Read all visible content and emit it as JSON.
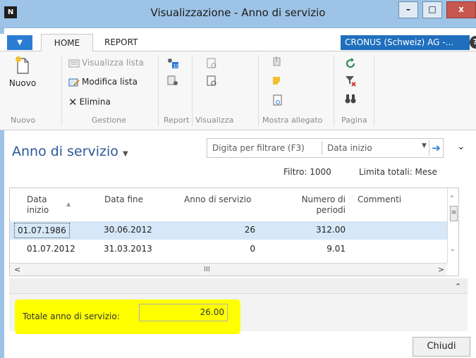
{
  "window": {
    "title": "Visualizzazione - Anno di servizio",
    "minimize": "–",
    "maximize": "□",
    "close": "x"
  },
  "ribbon": {
    "tabs": [
      {
        "label": "HOME"
      },
      {
        "label": "REPORT"
      }
    ],
    "company": "CRONUS (Schweiz) AG -...",
    "help": "?",
    "groups": {
      "nuovo": {
        "label": "Nuovo",
        "button": "Nuovo"
      },
      "gestione": {
        "label": "Gestione",
        "visualizza_lista": "Visualizza lista",
        "modifica_lista": "Modifica lista",
        "elimina": "Elimina"
      },
      "report": {
        "label": "Report"
      },
      "visualizza": {
        "label": "Visualizza"
      },
      "mostra_allegato": {
        "label": "Mostra allegato"
      },
      "pagina": {
        "label": "Pagina"
      }
    }
  },
  "page": {
    "title": "Anno di servizio",
    "filter_placeholder": "Digita per filtrare (F3)",
    "filter_field": "Data inizio",
    "filter_info": "Filtro: 1000",
    "limit_info": "Limita totali: Mese"
  },
  "grid": {
    "columns": {
      "data_inizio_1": "Data",
      "data_inizio_2": "inizio",
      "data_fine": "Data fine",
      "anno": "Anno di servizio",
      "periodi_1": "Numero di",
      "periodi_2": "periodi",
      "commenti": "Commenti"
    },
    "rows": [
      {
        "data_inizio": "01.07.1986",
        "data_fine": "30.06.2012",
        "anno": "26",
        "periodi": "312.00",
        "commenti": ""
      },
      {
        "data_inizio": "01.07.2012",
        "data_fine": "31.03.2013",
        "anno": "0",
        "periodi": "9.01",
        "commenti": ""
      }
    ]
  },
  "totals": {
    "label": "Totale anno di servizio:",
    "value": "26.00"
  },
  "footer": {
    "close_button": "Chiudi"
  },
  "colors": {
    "title_bar": "#9dc3e6",
    "accent": "#2b7cd3",
    "highlight": "#ffff00",
    "selected_row": "#d6e7f7"
  }
}
